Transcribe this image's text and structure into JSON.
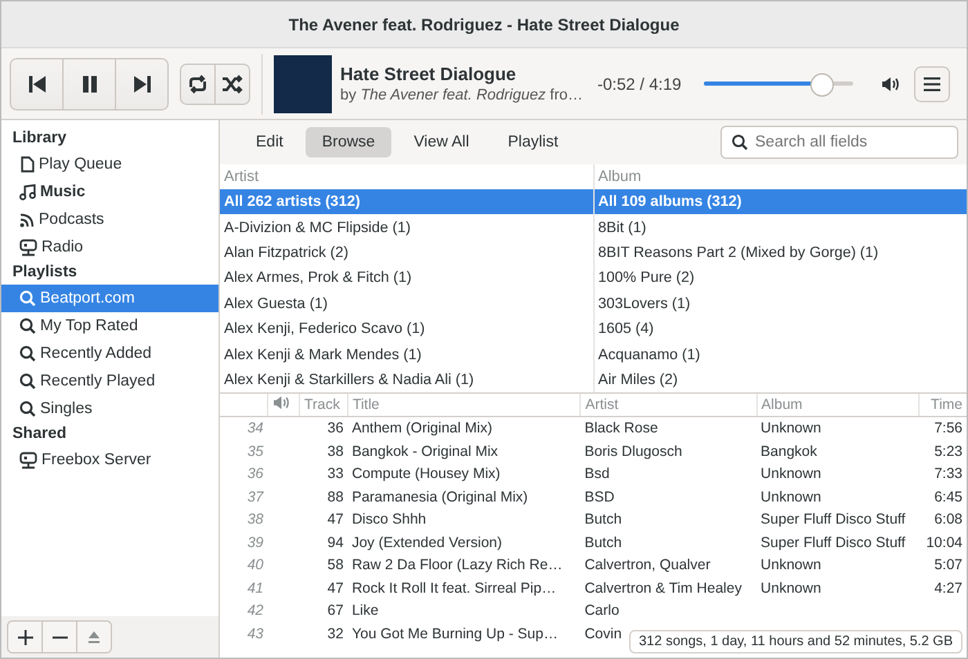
{
  "window": {
    "title": "The Avener feat. Rodriguez - Hate Street Dialogue"
  },
  "player": {
    "song_title": "Hate Street Dialogue",
    "byline": "by *The Avener feat. Rodriguez* fro…",
    "time": "-0:52 / 4:19",
    "seek": {
      "level": 0.79
    }
  },
  "sidebar": {
    "sections": [
      {
        "heading": "Library",
        "items": [
          {
            "kind": "document",
            "label": "Play Queue",
            "selected": false,
            "active": false
          },
          {
            "kind": "music",
            "label": "Music",
            "selected": false,
            "active": true
          },
          {
            "kind": "feed",
            "label": "Podcasts",
            "selected": false,
            "active": false
          },
          {
            "kind": "network",
            "label": "Radio",
            "selected": false,
            "active": false
          }
        ]
      },
      {
        "heading": "Playlists",
        "items": [
          {
            "kind": "search",
            "label": "Beatport.com",
            "selected": true,
            "active": false
          },
          {
            "kind": "search",
            "label": "My Top Rated",
            "selected": false,
            "active": false
          },
          {
            "kind": "search",
            "label": "Recently Added",
            "selected": false,
            "active": false
          },
          {
            "kind": "search",
            "label": "Recently Played",
            "selected": false,
            "active": false
          },
          {
            "kind": "search",
            "label": "Singles",
            "selected": false,
            "active": false
          }
        ]
      },
      {
        "heading": "Shared",
        "items": [
          {
            "kind": "network",
            "label": "Freebox Server",
            "selected": false,
            "active": false
          }
        ]
      }
    ]
  },
  "tabs": [
    {
      "label": "Edit",
      "selected": false
    },
    {
      "label": "Browse",
      "selected": true
    },
    {
      "label": "View All",
      "selected": false
    },
    {
      "label": "Playlist",
      "selected": false
    }
  ],
  "search": {
    "placeholder": "Search all fields"
  },
  "browser": [
    {
      "heading": "Artist",
      "rows": [
        {
          "label": "All 262 artists (312)",
          "selected": true
        },
        {
          "label": "A-Divizion & MC Flipside (1)",
          "selected": false
        },
        {
          "label": "Alan Fitzpatrick (2)",
          "selected": false
        },
        {
          "label": "Alex Armes, Prok & Fitch (1)",
          "selected": false
        },
        {
          "label": "Alex Guesta (1)",
          "selected": false
        },
        {
          "label": "Alex Kenji, Federico Scavo (1)",
          "selected": false
        },
        {
          "label": "Alex Kenji & Mark Mendes (1)",
          "selected": false
        },
        {
          "label": "Alex Kenji & Starkillers & Nadia Ali (1)",
          "selected": false
        }
      ]
    },
    {
      "heading": "Album",
      "rows": [
        {
          "label": "All 109 albums (312)",
          "selected": true
        },
        {
          "label": "8Bit (1)",
          "selected": false
        },
        {
          "label": "8BIT Reasons Part 2 (Mixed by Gorge) (1)",
          "selected": false
        },
        {
          "label": "100% Pure (2)",
          "selected": false
        },
        {
          "label": "303Lovers (1)",
          "selected": false
        },
        {
          "label": "1605 (4)",
          "selected": false
        },
        {
          "label": "Acquanamo (1)",
          "selected": false
        },
        {
          "label": "Air Miles (2)",
          "selected": false
        }
      ]
    }
  ],
  "songs": {
    "columns": [
      "Track",
      "Title",
      "Artist",
      "Album",
      "Time"
    ],
    "rows": [
      {
        "number": "34",
        "track": "36",
        "title": "Anthem (Original Mix)",
        "artist": "Black Rose",
        "album": "Unknown",
        "time": "7:56"
      },
      {
        "number": "35",
        "track": "38",
        "title": "Bangkok - Original Mix",
        "artist": "Boris Dlugosch",
        "album": "Bangkok",
        "time": "5:23"
      },
      {
        "number": "36",
        "track": "33",
        "title": "Compute (Housey Mix)",
        "artist": "Bsd",
        "album": "Unknown",
        "time": "7:33"
      },
      {
        "number": "37",
        "track": "88",
        "title": "Paramanesia (Original Mix)",
        "artist": "BSD",
        "album": "Unknown",
        "time": "6:45"
      },
      {
        "number": "38",
        "track": "47",
        "title": "Disco Shhh",
        "artist": "Butch",
        "album": "Super Fluff Disco Stuff",
        "time": "6:08"
      },
      {
        "number": "39",
        "track": "94",
        "title": "Joy (Extended Version)",
        "artist": "Butch",
        "album": "Super Fluff Disco Stuff",
        "time": "10:04"
      },
      {
        "number": "40",
        "track": "58",
        "title": "Raw 2 Da Floor (Lazy Rich Re…",
        "artist": "Calvertron, Qualver",
        "album": "Unknown",
        "time": "5:07"
      },
      {
        "number": "41",
        "track": "47",
        "title": "Rock It Roll It feat. Sirreal Pip…",
        "artist": "Calvertron & Tim Healey",
        "album": "Unknown",
        "time": "4:27"
      },
      {
        "number": "42",
        "track": "67",
        "title": "Like",
        "artist": "Carlo"
      },
      {
        "number": "43",
        "track": "32",
        "title": "You Got Me Burning Up - Sup…",
        "artist": "Covin"
      }
    ]
  },
  "status": "312 songs, 1 day, 11 hours and 52 minutes, 5.2 GB"
}
